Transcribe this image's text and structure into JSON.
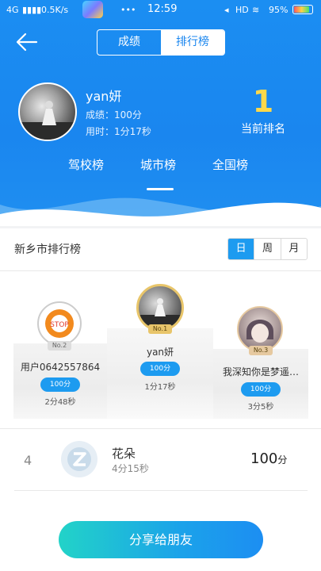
{
  "status_bar": {
    "network": "4G",
    "speed": "0.5K/s",
    "dots": "•••",
    "time": "12:59",
    "hd": "HD",
    "battery": "95%"
  },
  "header": {
    "segments": [
      "成绩",
      "排行榜"
    ],
    "active_segment": "排行榜",
    "user": {
      "name": "yan妍",
      "score": "成绩：100分",
      "time": "用时：1分17秒"
    },
    "rank": {
      "number": "1",
      "label": "当前排名"
    },
    "tabs": [
      "驾校榜",
      "城市榜",
      "全国榜"
    ],
    "active_tab": "城市榜"
  },
  "board": {
    "title": "新乡市排行榜",
    "periods": [
      "日",
      "周",
      "月"
    ],
    "active_period": "日",
    "podium": [
      {
        "place": "No.2",
        "name": "用户0642557864",
        "score": "100分",
        "time": "2分48秒"
      },
      {
        "place": "No.1",
        "name": "yan妍",
        "score": "100分",
        "time": "1分17秒"
      },
      {
        "place": "No.3",
        "name": "我深知你是梦遥…",
        "score": "100分",
        "time": "3分5秒"
      }
    ],
    "list": [
      {
        "rank": "4",
        "name": "花朵",
        "time": "4分15秒",
        "score": "100",
        "unit": "分"
      }
    ]
  },
  "share_button": "分享给朋友",
  "colors": {
    "header_blue": "#1a86ef",
    "rank_gold": "#ffd84a",
    "accent_blue": "#1d9bf0",
    "button_teal": "#22d3c8"
  }
}
